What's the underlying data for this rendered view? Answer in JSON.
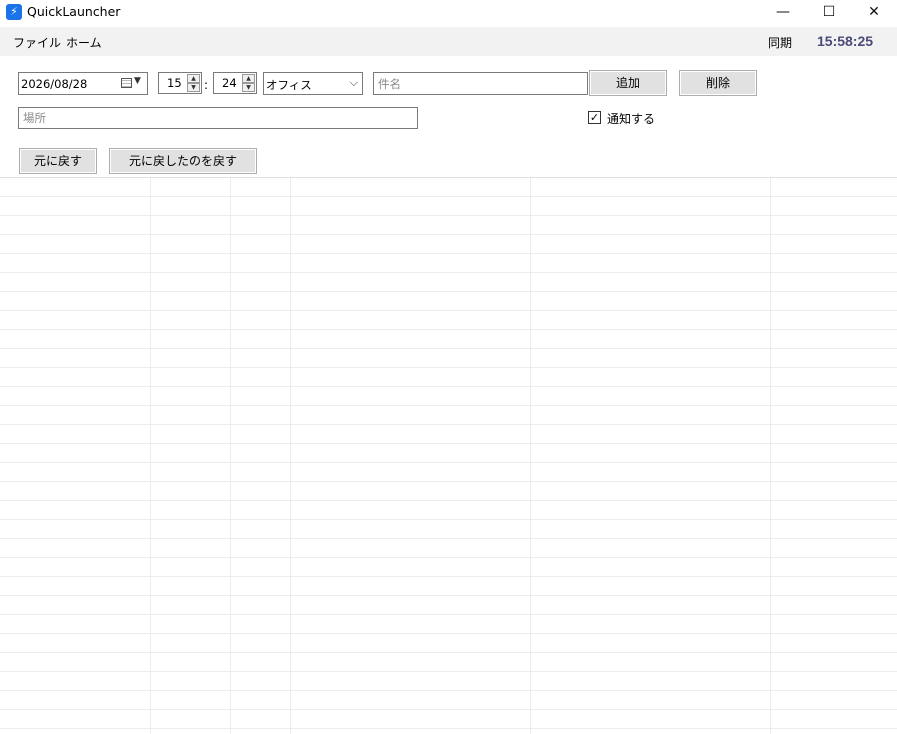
{
  "window": {
    "title": "QuickLauncher",
    "app_icon": "bolt-icon",
    "controls": {
      "minimize": "—",
      "maximize": "☐",
      "close": "✕"
    }
  },
  "menu": {
    "items": [
      {
        "label": "ファイル"
      },
      {
        "label": "ホーム"
      }
    ],
    "sync_label": "同期",
    "clock": "15:58:25"
  },
  "form": {
    "date_value": "2026/08/28",
    "hour_value": "15",
    "minute_value": "24",
    "time_separator": ":",
    "category_value": "オフィス",
    "subject_placeholder": "件名",
    "location_placeholder": "場所",
    "add_label": "追加",
    "delete_label": "削除",
    "notify_label": "通知する",
    "notify_checked": true,
    "undo_label": "元に戻す",
    "redo_label": "元に戻したのを戻す"
  },
  "colors": {
    "menubar_bg": "#f2f2f2",
    "clock": "#4a4a7a",
    "accent": "#1a73e8"
  }
}
